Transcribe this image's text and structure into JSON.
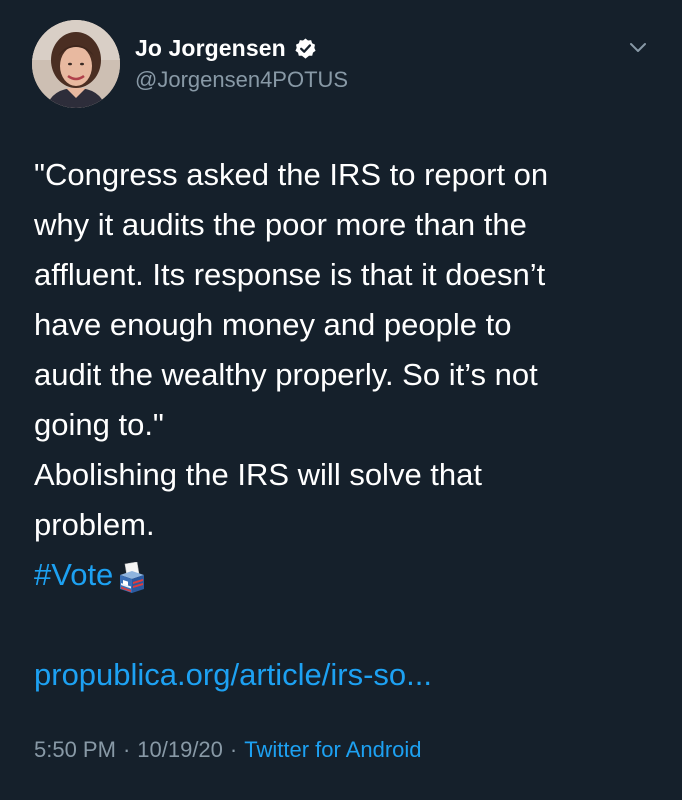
{
  "tweet": {
    "author": {
      "display_name": "Jo Jorgensen",
      "handle": "@Jorgensen4POTUS",
      "verified": true
    },
    "text_lines": [
      "\"Congress asked the IRS to report on",
      "why it audits the poor more than the",
      "affluent. Its response is that it doesn’t",
      "have enough money and people to",
      "audit the wealthy properly. So it’s not",
      "going to.\"",
      "Abolishing the IRS will solve that",
      "problem."
    ],
    "hashtag": "#Vote",
    "link": "propublica.org/article/irs-so...",
    "time": "5:50 PM",
    "date": "10/19/20",
    "source": "Twitter for Android",
    "separator": "·"
  },
  "icons": {
    "verified": "verified-badge-icon",
    "caret": "chevron-down-icon",
    "ballot": "ballot-box-emoji"
  },
  "colors": {
    "background": "#15202b",
    "text": "#ffffff",
    "secondary": "#8899a6",
    "accent": "#1da1f2"
  }
}
